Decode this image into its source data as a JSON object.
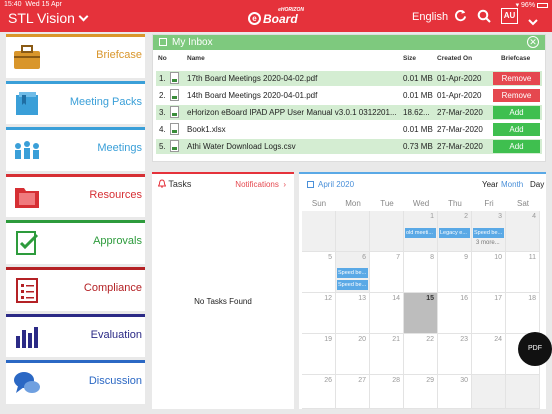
{
  "status": {
    "time": "15:40",
    "date": "Wed 15 Apr",
    "battery": "96%"
  },
  "header": {
    "title": "STL Vision",
    "logo_top": "eHORIZON",
    "logo_main": "Board",
    "logo_letter": "e",
    "language": "English",
    "avatar": "AU",
    "colors": {
      "bar": "#e5323b"
    }
  },
  "sidebar": {
    "items": [
      {
        "label": "Briefcase",
        "color": "#d9962b",
        "icon": "briefcase-icon"
      },
      {
        "label": "Meeting Packs",
        "color": "#3a9fd8",
        "icon": "meeting-packs-icon"
      },
      {
        "label": "Meetings",
        "color": "#3a9fd8",
        "icon": "meetings-icon"
      },
      {
        "label": "Resources",
        "color": "#d62f34",
        "icon": "resources-folder-icon"
      },
      {
        "label": "Approvals",
        "color": "#2d9b3c",
        "icon": "approvals-icon"
      },
      {
        "label": "Compliance",
        "color": "#b42125",
        "icon": "compliance-icon"
      },
      {
        "label": "Evaluation",
        "color": "#2b2a86",
        "icon": "evaluation-chart-icon"
      },
      {
        "label": "Discussion",
        "color": "#2b68c4",
        "icon": "discussion-icon"
      }
    ]
  },
  "inbox": {
    "title": "My Inbox",
    "columns": {
      "no": "No",
      "name": "Name",
      "size": "Size",
      "created": "Created On",
      "briefcase": "Briefcase"
    },
    "rows": [
      {
        "no": "1.",
        "name": "17th Board Meetings 2020-04-02.pdf",
        "size": "0.01 MB",
        "created": "01-Apr-2020",
        "action": "Remove"
      },
      {
        "no": "2.",
        "name": "14th Board Meetings 2020-04-01.pdf",
        "size": "0.01 MB",
        "created": "01-Apr-2020",
        "action": "Remove"
      },
      {
        "no": "3.",
        "name": "eHorizon eBoard IPAD APP User Manual v3.0.1 0312201...",
        "size": "18.62...",
        "created": "27-Mar-2020",
        "action": "Add"
      },
      {
        "no": "4.",
        "name": "Book1.xlsx",
        "size": "0.01 MB",
        "created": "27-Mar-2020",
        "action": "Add"
      },
      {
        "no": "5.",
        "name": "Athi Water Download Logs.csv",
        "size": "0.73 MB",
        "created": "27-Mar-2020",
        "action": "Add"
      }
    ]
  },
  "tasks": {
    "title": "Tasks",
    "notifications": "Notifications",
    "empty": "No Tasks Found"
  },
  "calendar": {
    "month": "April 2020",
    "views": {
      "year": "Year",
      "month": "Month",
      "day": "Day"
    },
    "weekdays": [
      "Sun",
      "Mon",
      "Tue",
      "Wed",
      "Thu",
      "Fri",
      "Sat"
    ],
    "weeks": [
      [
        "",
        "",
        "",
        "1",
        "2",
        "3",
        "4"
      ],
      [
        "5",
        "6",
        "7",
        "8",
        "9",
        "10",
        "11"
      ],
      [
        "12",
        "13",
        "14",
        "15",
        "16",
        "17",
        "18"
      ],
      [
        "19",
        "20",
        "21",
        "22",
        "23",
        "24",
        "25"
      ],
      [
        "26",
        "27",
        "28",
        "29",
        "30",
        "",
        ""
      ]
    ],
    "events": {
      "e1": "old meeti...",
      "e2": "Legacy e...",
      "e3": "Speed be...",
      "more": "3 more...",
      "e4": "Speed be...",
      "e5": "Speed be..."
    }
  },
  "pdf_button": "PDF"
}
